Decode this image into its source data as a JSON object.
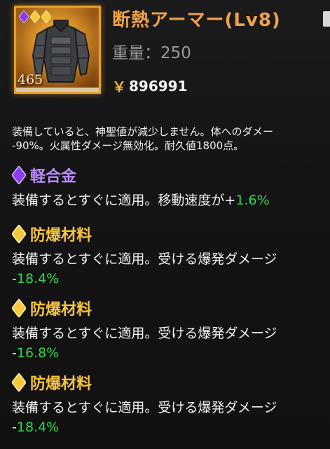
{
  "item": {
    "name": "断熱アーマー(Lv8)",
    "weight_label": "重量：",
    "weight_value": "250",
    "price_symbol": "￥",
    "price": "896991",
    "durability": "465",
    "image_icon": "armor-icon",
    "gem_count": 3,
    "gem_colors": [
      "#8b3cf0",
      "#f6c83a",
      "#f6c83a"
    ]
  },
  "description": {
    "line1": "装備していると、神聖値が減少しません。体へのダメー",
    "line2": "-90%。火属性ダメージ無効化。耐久値1800点。"
  },
  "mods": [
    {
      "name": "軽合金",
      "gem": "purple",
      "desc_prefix": "装備するとすぐに適用。移動速度が+",
      "value": "1.6%"
    },
    {
      "name": "防爆材料",
      "gem": "gold",
      "desc_prefix": "装備するとすぐに適用。受ける爆発ダメージ",
      "value_prefix": "-",
      "value": "18.4%"
    },
    {
      "name": "防爆材料",
      "gem": "gold",
      "desc_prefix": "装備するとすぐに適用。受ける爆発ダメージ",
      "value_prefix": "-",
      "value": "16.8%"
    },
    {
      "name": "防爆材料",
      "gem": "gold",
      "desc_prefix": "装備するとすぐに適用。受ける爆発ダメージ",
      "value_prefix": "-",
      "value": "18.4%"
    }
  ],
  "colors": {
    "name": "#f0a24a",
    "value_green": "#2fd84a",
    "purple_gem": "#8b3cf0",
    "gold_gem": "#f6c83a"
  }
}
